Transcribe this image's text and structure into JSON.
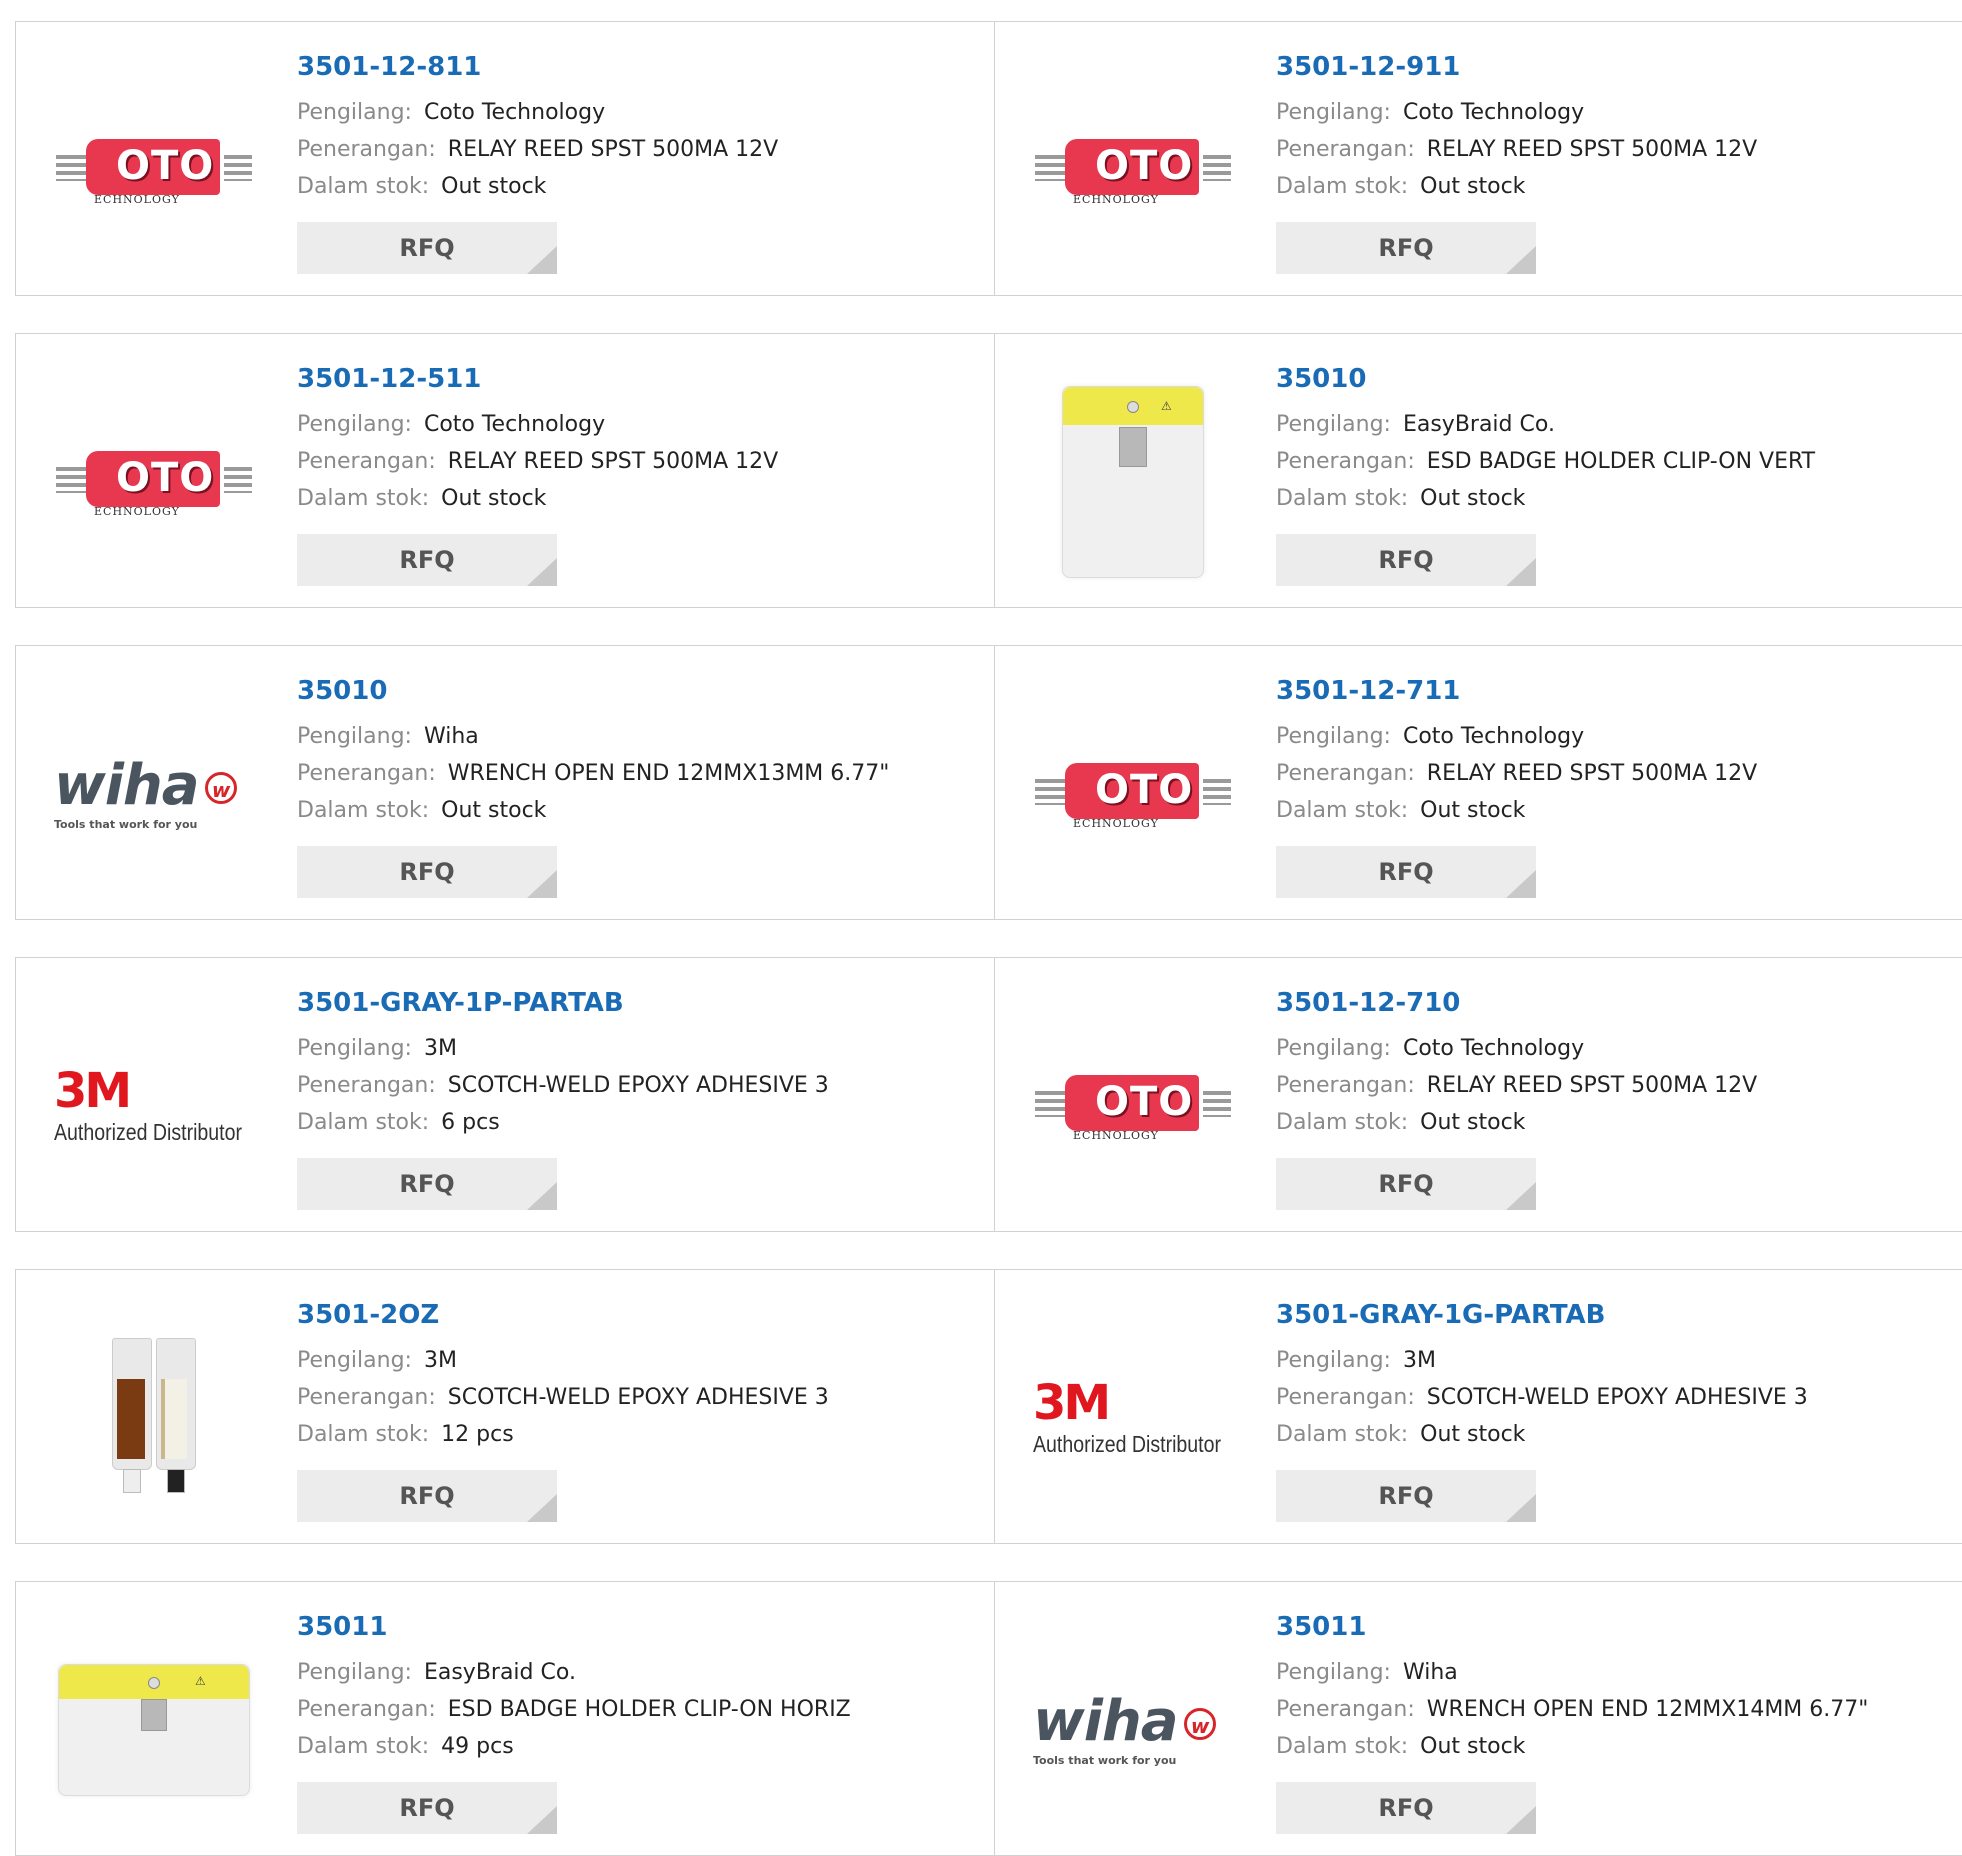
{
  "labels": {
    "manufacturer": "Pengilang:",
    "description": "Penerangan:",
    "stock": "Dalam stok:",
    "rfq": "RFQ"
  },
  "products": [
    {
      "part": "3501-12-811",
      "manufacturer": "Coto Technology",
      "description": "RELAY REED SPST 500MA 12V",
      "stock": "Out stock",
      "image": "coto-logo"
    },
    {
      "part": "3501-12-911",
      "manufacturer": "Coto Technology",
      "description": "RELAY REED SPST 500MA 12V",
      "stock": "Out stock",
      "image": "coto-logo"
    },
    {
      "part": "3501-12-511",
      "manufacturer": "Coto Technology",
      "description": "RELAY REED SPST 500MA 12V",
      "stock": "Out stock",
      "image": "coto-logo"
    },
    {
      "part": "35010",
      "manufacturer": "EasyBraid Co.",
      "description": "ESD BADGE HOLDER CLIP-ON VERT",
      "stock": "Out stock",
      "image": "badge-holder-vertical"
    },
    {
      "part": "35010",
      "manufacturer": "Wiha",
      "description": "WRENCH OPEN END 12MMX13MM 6.77\"",
      "stock": "Out stock",
      "image": "wiha-logo"
    },
    {
      "part": "3501-12-711",
      "manufacturer": "Coto Technology",
      "description": "RELAY REED SPST 500MA 12V",
      "stock": "Out stock",
      "image": "coto-logo"
    },
    {
      "part": "3501-GRAY-1P-PARTAB",
      "manufacturer": "3M",
      "description": "SCOTCH-WELD EPOXY ADHESIVE 3",
      "stock": "6 pcs",
      "image": "3m-logo"
    },
    {
      "part": "3501-12-710",
      "manufacturer": "Coto Technology",
      "description": "RELAY REED SPST 500MA 12V",
      "stock": "Out stock",
      "image": "coto-logo"
    },
    {
      "part": "3501-2OZ",
      "manufacturer": "3M",
      "description": "SCOTCH-WELD EPOXY ADHESIVE 3",
      "stock": "12 pcs",
      "image": "adhesive-tubes"
    },
    {
      "part": "3501-GRAY-1G-PARTAB",
      "manufacturer": "3M",
      "description": "SCOTCH-WELD EPOXY ADHESIVE 3",
      "stock": "Out stock",
      "image": "3m-logo"
    },
    {
      "part": "35011",
      "manufacturer": "EasyBraid Co.",
      "description": "ESD BADGE HOLDER CLIP-ON HORIZ",
      "stock": "49 pcs",
      "image": "badge-holder-horizontal"
    },
    {
      "part": "35011",
      "manufacturer": "Wiha",
      "description": "WRENCH OPEN END 12MMX14MM 6.77\"",
      "stock": "Out stock",
      "image": "wiha-logo"
    }
  ],
  "logos": {
    "coto_text": "OTO",
    "coto_sub": "ECHNOLOGY",
    "wiha_text": "wiha",
    "wiha_mark": "w",
    "wiha_tagline": "Tools that work for you",
    "m3_text": "3M",
    "m3_tagline": "Authorized Distributor",
    "esd_symbol": "⚠"
  }
}
